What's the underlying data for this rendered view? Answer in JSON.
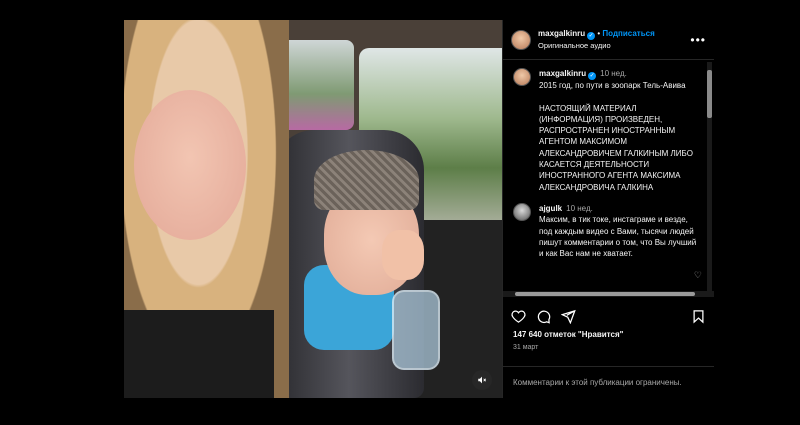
{
  "post": {
    "username": "maxgalkinru",
    "follow_label": "Подписаться",
    "audio_label": "Оригинальное аудио",
    "more_label": "•••"
  },
  "caption": {
    "username": "maxgalkinru",
    "time": "10 нед.",
    "text": "2015 год, по пути в зоопарк Тель-Авива\n\nНАСТОЯЩИЙ МАТЕРИАЛ (ИНФОРМАЦИЯ) ПРОИЗВЕДЕН, РАСПРОСТРАНЕН ИНОСТРАННЫМ АГЕНТОМ МАКСИМОМ АЛЕКСАНДРОВИЧЕМ ГАЛКИНЫМ ЛИБО КАСАЕТСЯ ДЕЯТЕЛЬНОСТИ ИНОСТРАННОГО АГЕНТА МАКСИМА АЛЕКСАНДРОВИЧА ГАЛКИНА"
  },
  "comments": [
    {
      "username": "ajgulk",
      "time": "10 нед.",
      "text": "Максим, в тик токе, инстаграме и везде, под каждым видео с Вами, тысячи людей пишут комментарии о том, что Вы лучший и как Вас нам не хватает."
    }
  ],
  "stats": {
    "likes": "147 640 отметок \"Нравится\"",
    "date": "31 март"
  },
  "footer": {
    "comments_closed": "Комментарии к этой публикации ограничены."
  },
  "icons": {
    "verified": "✓",
    "mute": "🔇"
  },
  "colors": {
    "accent": "#0095f6",
    "background": "#000000",
    "secondary_text": "#a8a8a8"
  }
}
